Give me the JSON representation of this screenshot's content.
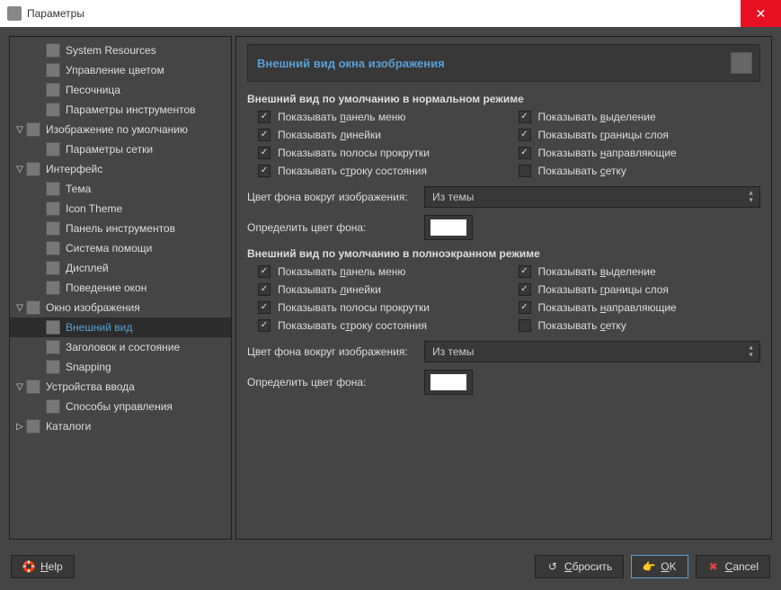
{
  "window": {
    "title": "Параметры"
  },
  "tree": [
    {
      "indent": 1,
      "exp": "",
      "label": "System Resources"
    },
    {
      "indent": 1,
      "exp": "",
      "label": "Управление цветом"
    },
    {
      "indent": 1,
      "exp": "",
      "label": "Песочница"
    },
    {
      "indent": 1,
      "exp": "",
      "label": "Параметры инструментов"
    },
    {
      "indent": 0,
      "exp": "▽",
      "label": "Изображение по умолчанию"
    },
    {
      "indent": 1,
      "exp": "",
      "label": "Параметры сетки"
    },
    {
      "indent": 0,
      "exp": "▽",
      "label": "Интерфейс"
    },
    {
      "indent": 1,
      "exp": "",
      "label": "Тема"
    },
    {
      "indent": 1,
      "exp": "",
      "label": "Icon Theme"
    },
    {
      "indent": 1,
      "exp": "",
      "label": "Панель инструментов"
    },
    {
      "indent": 1,
      "exp": "",
      "label": "Система помощи"
    },
    {
      "indent": 1,
      "exp": "",
      "label": "Дисплей"
    },
    {
      "indent": 1,
      "exp": "",
      "label": "Поведение окон"
    },
    {
      "indent": 0,
      "exp": "▽",
      "label": "Окно изображения"
    },
    {
      "indent": 1,
      "exp": "",
      "label": "Внешний вид",
      "selected": true
    },
    {
      "indent": 1,
      "exp": "",
      "label": "Заголовок и состояние"
    },
    {
      "indent": 1,
      "exp": "",
      "label": "Snapping"
    },
    {
      "indent": 0,
      "exp": "▽",
      "label": "Устройства ввода"
    },
    {
      "indent": 1,
      "exp": "",
      "label": "Способы управления"
    },
    {
      "indent": 0,
      "exp": "▷",
      "label": "Каталоги"
    }
  ],
  "page": {
    "title": "Внешний вид окна изображения",
    "section_normal": "Внешний вид по умолчанию в нормальном режиме",
    "section_full": "Внешний вид по умолчанию в полноэкранном режиме",
    "checks_normal": {
      "menu": {
        "checked": true,
        "label": "Показывать <u>п</u>анель меню"
      },
      "rulers": {
        "checked": true,
        "label": "Показывать <u>л</u>инейки"
      },
      "scroll": {
        "checked": true,
        "label": "Показывать полосы прокрутки"
      },
      "status": {
        "checked": true,
        "label": "Показывать с<u>т</u>року состояния"
      },
      "selection": {
        "checked": true,
        "label": "Показывать <u>в</u>ыделение"
      },
      "layer": {
        "checked": true,
        "label": "Показывать <u>г</u>раницы слоя"
      },
      "guides": {
        "checked": true,
        "label": "Показывать <u>н</u>аправляющие"
      },
      "grid": {
        "checked": false,
        "label": "Показывать <u>с</u>етку"
      }
    },
    "checks_full": {
      "menu": {
        "checked": true,
        "label": "Показывать <u>п</u>анель меню"
      },
      "rulers": {
        "checked": true,
        "label": "Показывать <u>л</u>инейки"
      },
      "scroll": {
        "checked": true,
        "label": "Показывать полосы прокрутки"
      },
      "status": {
        "checked": true,
        "label": "Показывать с<u>т</u>року состояния"
      },
      "selection": {
        "checked": true,
        "label": "Показывать <u>в</u>ыделение"
      },
      "layer": {
        "checked": true,
        "label": "Показывать <u>г</u>раницы слоя"
      },
      "guides": {
        "checked": true,
        "label": "Показывать <u>н</u>аправляющие"
      },
      "grid": {
        "checked": false,
        "label": "Показывать <u>с</u>етку"
      }
    },
    "bg_around_label": "Цвет фона вокруг изображения:",
    "bg_around_value": "Из темы",
    "define_bg_label": "Определить цвет фона:",
    "define_bg_color": "#ffffff"
  },
  "footer": {
    "help": "<u>H</u>elp",
    "reset": "<u>С</u>бросить",
    "ok": "<u>O</u>K",
    "cancel": "<u>C</u>ancel"
  }
}
